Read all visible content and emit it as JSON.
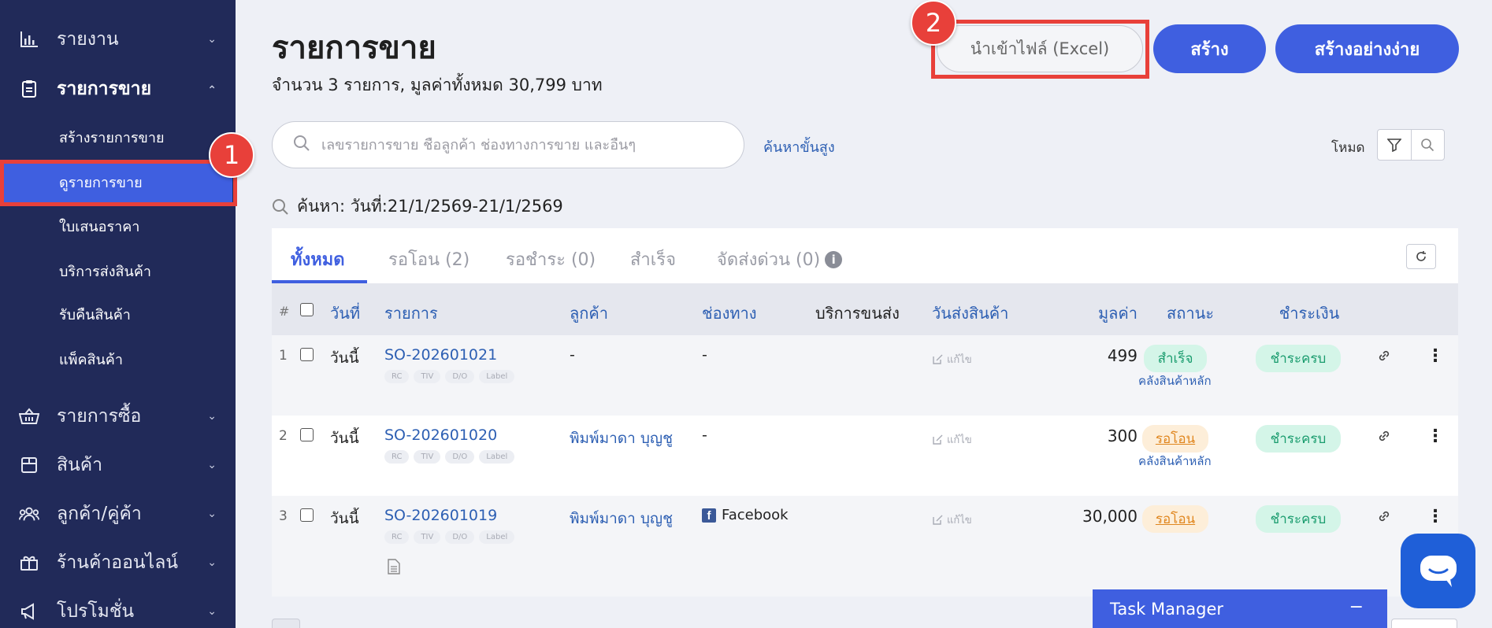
{
  "sidebar": {
    "items": [
      {
        "label": "รายงาน",
        "icon": "bar-chart-icon",
        "expanded": false
      },
      {
        "label": "รายการขาย",
        "icon": "clipboard-icon",
        "expanded": true
      },
      {
        "label": "รายการซื้อ",
        "icon": "basket-icon",
        "expanded": false
      },
      {
        "label": "สินค้า",
        "icon": "box-icon",
        "expanded": false
      },
      {
        "label": "ลูกค้า/คู่ค้า",
        "icon": "users-icon",
        "expanded": false
      },
      {
        "label": "ร้านค้าออนไลน์",
        "icon": "gift-shop-icon",
        "expanded": false
      },
      {
        "label": "โปรโมชั่น",
        "icon": "megaphone-icon",
        "expanded": false
      }
    ],
    "sub_items": [
      "สร้างรายการขาย",
      "ดูรายการขาย",
      "ใบเสนอราคา",
      "บริการส่งสินค้า",
      "รับคืนสินค้า",
      "แพ็คสินค้า"
    ],
    "active_sub": "ดูรายการขาย"
  },
  "annotations": {
    "badge1": "1",
    "badge2": "2"
  },
  "header": {
    "title": "รายการขาย",
    "summary": "จำนวน 3 รายการ, มูลค่าทั้งหมด 30,799 บาท",
    "import_button": "นำเข้าไฟล์ (Excel)",
    "create_button": "สร้าง",
    "quick_create_button": "สร้างอย่างง่าย"
  },
  "search": {
    "placeholder": "เลขรายการขาย ชื่อลูกค้า ช่องทางการขาย และอื่นๆ",
    "advanced": "ค้นหาขั้นสูง",
    "mode_label": "โหมด",
    "query": "ค้นหา: วันที่:21/1/2569-21/1/2569"
  },
  "tabs": [
    "ทั้งหมด",
    "รอโอน (2)",
    "รอชำระ (0)",
    "สำเร็จ",
    "จัดส่งด่วน (0)"
  ],
  "table": {
    "headers": {
      "hash": "#",
      "date": "วันที่",
      "order": "รายการ",
      "customer": "ลูกค้า",
      "channel": "ช่องทาง",
      "shipping": "บริการขนส่ง",
      "ship_date": "วันส่งสินค้า",
      "value": "มูลค่า",
      "status": "สถานะ",
      "payment": "ชำระเงิน"
    },
    "tags": [
      "RC",
      "TIV",
      "D/O",
      "Label"
    ],
    "edit_label": "แก้ไข",
    "rows": [
      {
        "no": "1",
        "date": "วันนี้",
        "order": "SO-202601021",
        "customer": "-",
        "channel": "-",
        "value": "499",
        "status": "สำเร็จ",
        "status_type": "green",
        "warehouse": "คลังสินค้าหลัก",
        "payment": "ชำระครบ"
      },
      {
        "no": "2",
        "date": "วันนี้",
        "order": "SO-202601020",
        "customer": "พิมพ์มาดา บุญชู",
        "channel": "-",
        "value": "300",
        "status": "รอโอน",
        "status_type": "orange",
        "warehouse": "คลังสินค้าหลัก",
        "payment": "ชำระครบ"
      },
      {
        "no": "3",
        "date": "วันนี้",
        "order": "SO-202601019",
        "customer": "พิมพ์มาดา บุญชู",
        "channel": "Facebook",
        "value": "30,000",
        "status": "รอโอน",
        "status_type": "orange",
        "warehouse": "",
        "payment": "ชำระครบ"
      }
    ]
  },
  "task_manager": {
    "title": "Task Manager",
    "minimize": "−"
  },
  "colors": {
    "sidebar": "#212a59",
    "primary": "#3f5fe0",
    "highlight": "#e8403a",
    "link": "#2d5fb3"
  }
}
